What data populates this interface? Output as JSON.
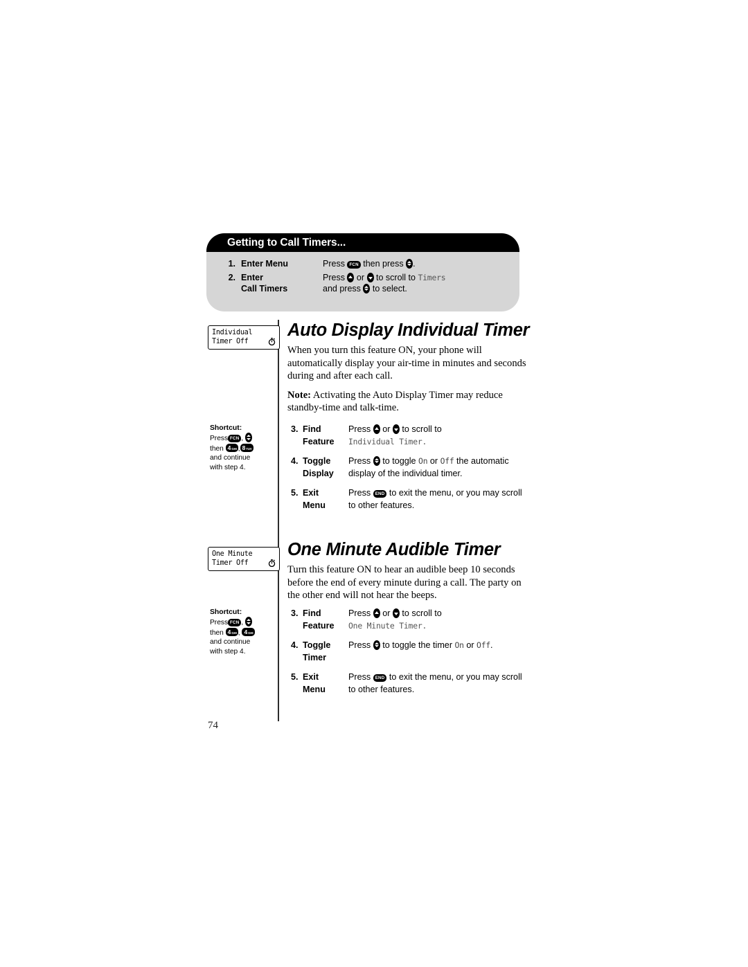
{
  "page": {
    "number": "74"
  },
  "banner": {
    "title": "Getting to Call Timers...",
    "steps": [
      {
        "num": "1.",
        "label_line1": "Enter Menu",
        "label_line2": "",
        "desc_line1_pre": "Press",
        "desc_line1_mid": "then press",
        "desc_line1_post": ".",
        "desc_line2": ""
      },
      {
        "num": "2.",
        "label_line1": "Enter",
        "label_line2": "Call Timers",
        "desc_line1_pre": "Press",
        "desc_line1_mid": "or",
        "desc_line1_post": "to scroll to",
        "desc_line1_mono": "Timers",
        "desc_line2_pre": "and press",
        "desc_line2_post": "to select."
      }
    ]
  },
  "sections": [
    {
      "lcd": {
        "line1": "Individual",
        "line2": "Timer Off",
        "icon": "stopwatch-icon"
      },
      "title": "Auto Display Individual Timer",
      "body_paragraph": "When you turn this feature ON, your phone will automatically display your air-time in minutes and seconds during and after each call.",
      "note_label": "Note:",
      "note_text": " Activating the Auto Display Timer may reduce standby-time and talk-time.",
      "shortcut": {
        "heading": "Shortcut:",
        "press_label": "Press",
        "then_label": "then",
        "key1": {
          "digit": "4",
          "sub1": "GHI",
          "sub2": ""
        },
        "key2": {
          "digit": "8",
          "sub1": "TUV",
          "sub2": ""
        },
        "tail_line1": "and continue",
        "tail_line2": "with step 4."
      },
      "steps": [
        {
          "num": "3.",
          "label_line1": "Find",
          "label_line2": "Feature",
          "desc_pre": "Press",
          "desc_mid": "or",
          "desc_post": "to scroll to",
          "desc_mono": "Individual Timer."
        },
        {
          "num": "4.",
          "label_line1": "Toggle",
          "label_line2": "Display",
          "desc_pre": "Press",
          "desc_mid": "to toggle",
          "desc_on": "On",
          "desc_or": "or",
          "desc_off": "Off",
          "desc_post": "the automatic",
          "desc_line2": "display of the individual timer."
        },
        {
          "num": "5.",
          "label_line1": "Exit",
          "label_line2": "Menu",
          "desc_pre": "Press",
          "desc_post": "to exit the menu, or you may scroll",
          "desc_line2": "to other features."
        }
      ]
    },
    {
      "lcd": {
        "line1": "One Minute",
        "line2": "Timer Off",
        "icon": "stopwatch-icon"
      },
      "title": "One Minute Audible Timer",
      "body_paragraph": "Turn this feature ON to hear an audible beep 10 seconds before the end of every minute during a call. The party on the other end will not hear the beeps.",
      "shortcut": {
        "heading": "Shortcut:",
        "press_label": "Press",
        "then_label": "then",
        "key1": {
          "digit": "4",
          "sub1": "GHI",
          "sub2": ""
        },
        "key2": {
          "digit": "4",
          "sub1": "GHI",
          "sub2": ""
        },
        "tail_line1": "and continue",
        "tail_line2": "with step 4."
      },
      "steps": [
        {
          "num": "3.",
          "label_line1": "Find",
          "label_line2": "Feature",
          "desc_pre": "Press",
          "desc_mid": "or",
          "desc_post": "to scroll to",
          "desc_mono": "One Minute Timer."
        },
        {
          "num": "4.",
          "label_line1": "Toggle",
          "label_line2": "Timer",
          "desc_pre": "Press",
          "desc_mid": "to toggle the timer",
          "desc_on": "On",
          "desc_or": "or",
          "desc_off": "Off",
          "desc_post": "."
        },
        {
          "num": "5.",
          "label_line1": "Exit",
          "label_line2": "Menu",
          "desc_pre": "Press",
          "desc_post": "to exit the menu, or you may scroll",
          "desc_line2": "to other features."
        }
      ]
    }
  ],
  "keys": {
    "fcn": "FCN",
    "end": "END"
  },
  "colors": {
    "banner_header_bg": "#000000",
    "banner_body_bg": "#d6d6d6",
    "text": "#000000",
    "lcd_text": "#555555"
  }
}
